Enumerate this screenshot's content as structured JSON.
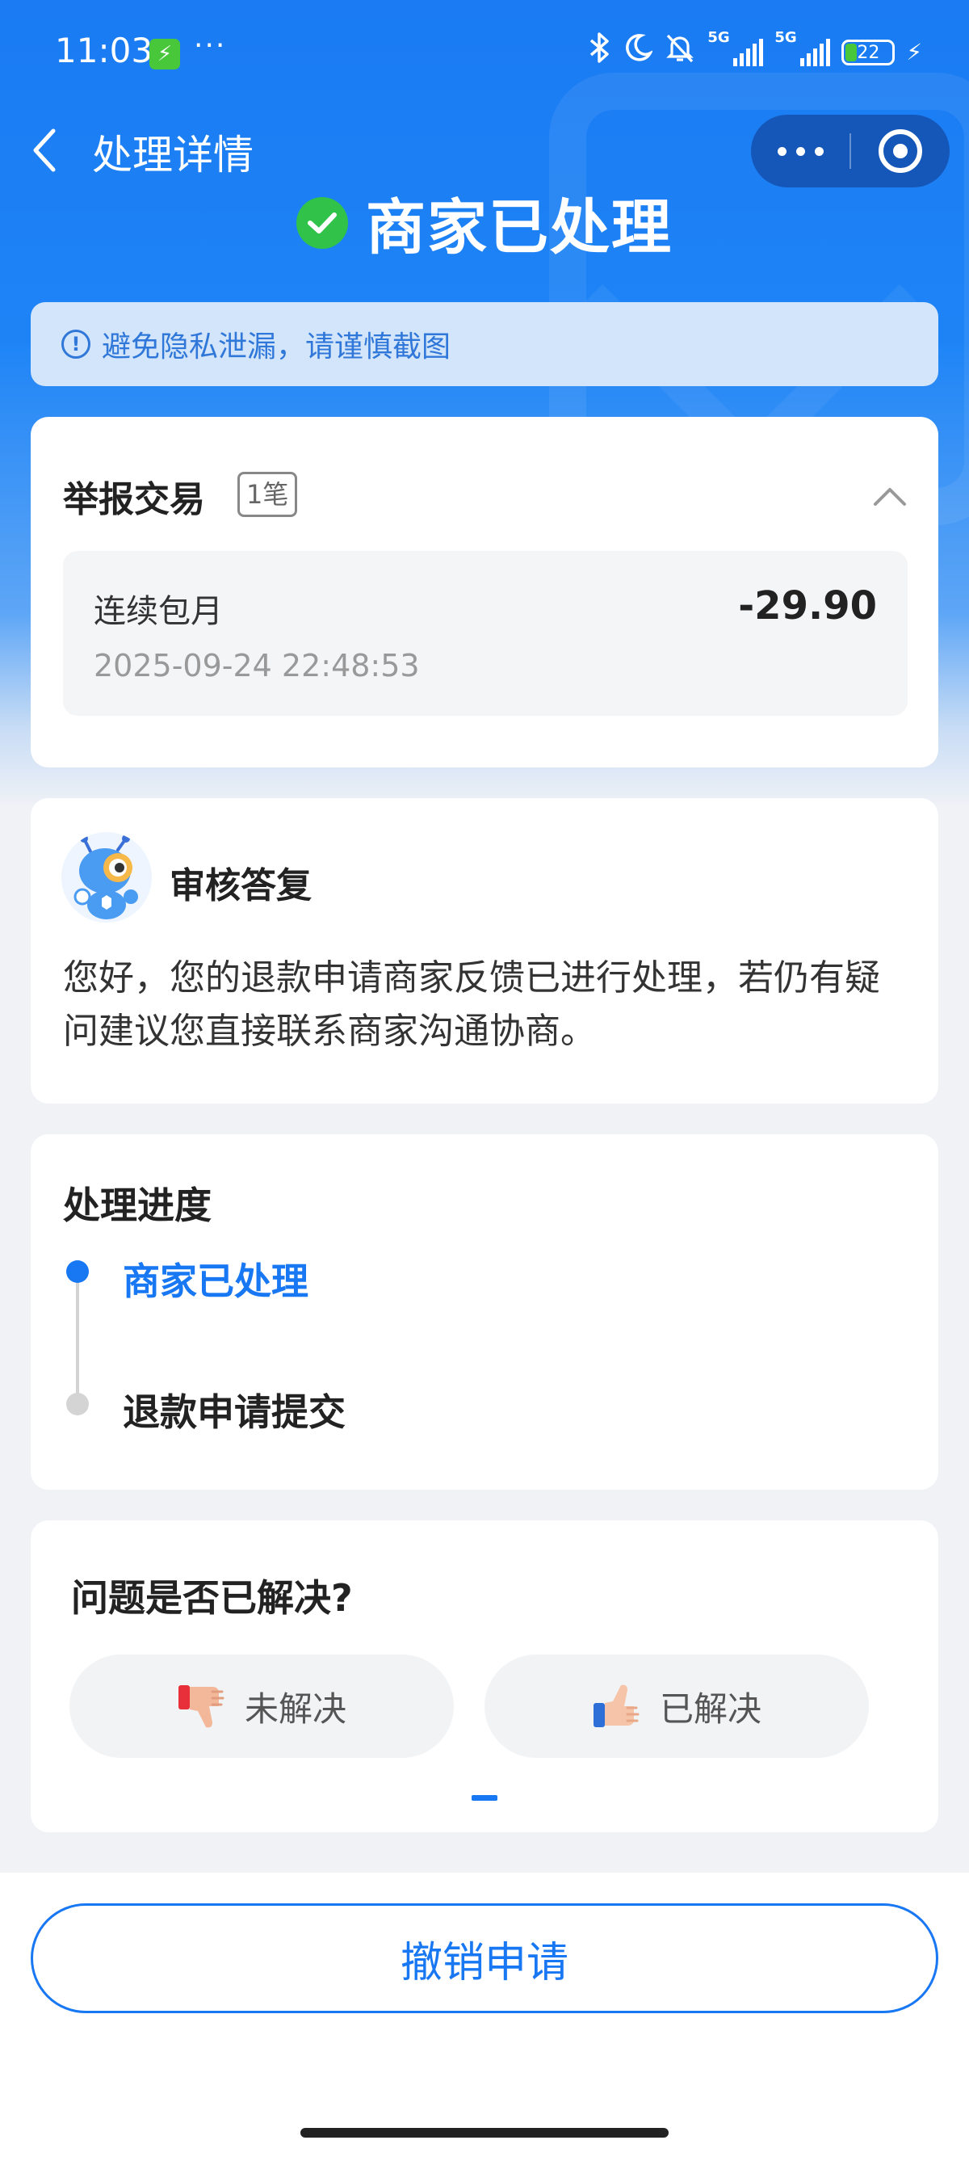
{
  "status_bar": {
    "time": "11:03",
    "charge_icon": "bolt-icon",
    "dots": "···",
    "signal1_label": "5G",
    "signal2_label": "5G",
    "battery": "22"
  },
  "nav": {
    "title": "处理详情",
    "back_icon": "chevron-left-icon",
    "more_icon": "more-icon",
    "target_icon": "target-icon"
  },
  "header": {
    "status": "商家已处理",
    "status_color": "#31c24a"
  },
  "privacy_notice": "避免隐私泄漏，请谨慎截图",
  "transaction": {
    "title": "举报交易",
    "count": "1笔",
    "item": {
      "name": "连续包月",
      "amount": "-29.90",
      "time": "2025-09-24 22:48:53"
    }
  },
  "reply": {
    "title": "审核答复",
    "text": "您好，您的退款申请商家反馈已进行处理，若仍有疑问建议您直接联系商家沟通协商。"
  },
  "progress": {
    "title": "处理进度",
    "steps": [
      "商家已处理",
      "退款申请提交"
    ],
    "active_color": "#1877f2"
  },
  "feedback": {
    "title": "问题是否已解决?",
    "unresolved": "未解决",
    "resolved": "已解决"
  },
  "action": {
    "cancel": "撤销申请",
    "accent": "#1877f2"
  }
}
